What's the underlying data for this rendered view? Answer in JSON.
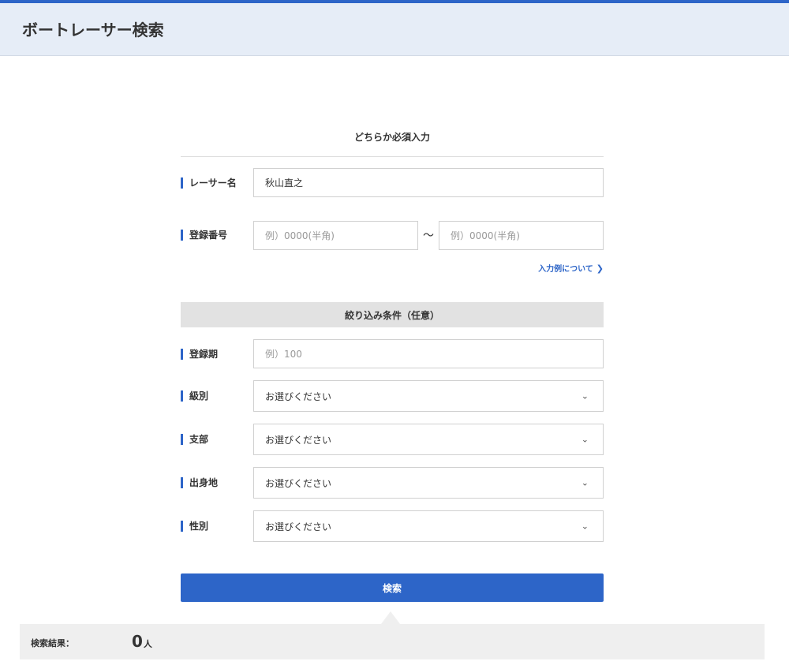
{
  "header": {
    "title": "ボートレーサー検索"
  },
  "required_section": {
    "title": "どちらか必須入力"
  },
  "racer_name": {
    "label": "レーサー名",
    "value": "秋山直之"
  },
  "registration_number": {
    "label": "登録番号",
    "from_placeholder": "例）0000(半角)",
    "separator": "～",
    "to_placeholder": "例）0000(半角)",
    "help_link": "入力例について",
    "help_icon": "chevron-right-icon"
  },
  "filter_section": {
    "title": "絞り込み条件（任意）"
  },
  "term": {
    "label": "登録期",
    "placeholder": "例）100"
  },
  "rank": {
    "label": "級別",
    "selected": "お選びください"
  },
  "branch": {
    "label": "支部",
    "selected": "お選びください"
  },
  "birthplace": {
    "label": "出身地",
    "selected": "お選びください"
  },
  "gender": {
    "label": "性別",
    "selected": "お選びください"
  },
  "select_icon": "chevron-down-icon",
  "search_button": {
    "label": "検索"
  },
  "results": {
    "label": "検索結果：",
    "count": "0",
    "unit": "人"
  },
  "colors": {
    "accent": "#2d65c8",
    "header_bg": "#e6edf7",
    "band_bg": "#e2e2e2",
    "results_bg": "#efefef"
  }
}
